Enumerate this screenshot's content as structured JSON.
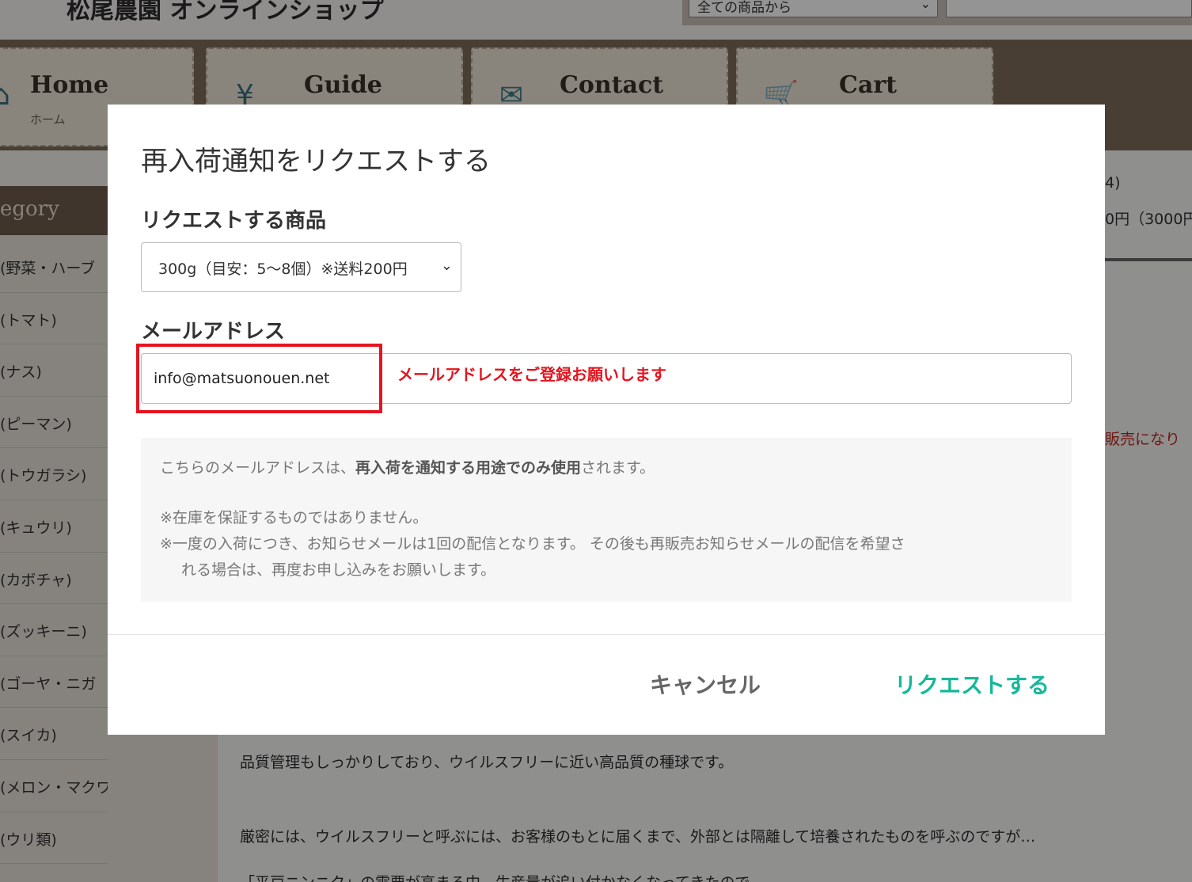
{
  "site": {
    "logo": "松尾農園 オンラインショップ",
    "search_scope": "全ての商品から"
  },
  "nav": {
    "tabs": [
      {
        "label": "Home",
        "sub": "ホーム"
      },
      {
        "label": "Guide",
        "sub": ""
      },
      {
        "label": "Contact",
        "sub": ""
      },
      {
        "label": "Cart",
        "sub": ""
      }
    ]
  },
  "sidebar": {
    "heading": "egory",
    "items": [
      "(野菜・ハーブ",
      "(トマト)",
      "(ナス)",
      "(ピーマン)",
      "(トウガラシ)",
      "(キュウリ)",
      "(カボチャ)",
      "(ズッキーニ)",
      "(ゴーヤ・ニガ",
      "(スイカ)",
      "(メロン・マクワウリ)",
      "(ウリ類)"
    ]
  },
  "main": {
    "right_line1": "4)",
    "right_line2": "0円（3000円",
    "right_red": "販売になり",
    "para1": "品質管理もしっかりしており、ウイルスフリーに近い高品質の種球です。",
    "para2": "厳密には、ウイルスフリーと呼ぶには、お客様のもとに届くまで、外部とは隔離して培養されたものを呼ぶのですが…",
    "para3": "「平戸ニンニク」の需要が高まる中、生産量が追い付かなくなってきたので"
  },
  "modal": {
    "title": "再入荷通知をリクエストする",
    "product_label": "リクエストする商品",
    "product_selected": "300g（目安：5〜8個）※送料200円",
    "email_label": "メールアドレス",
    "email_value": "info@matsuonouen.net",
    "annotation": "メールアドレスをご登録お願いします",
    "notice": {
      "line1_pre": "こちらのメールアドレスは、",
      "line1_strong": "再入荷を通知する用途でのみ使用",
      "line1_post": "されます。",
      "line2": "※在庫を保証するものではありません。",
      "line3": "※一度の入荷につき、お知らせメールは1回の配信となります。 その後も再販売お知らせメールの配信を希望さ",
      "line4": "れる場合は、再度お申し込みをお願いします。"
    },
    "cancel_label": "キャンセル",
    "submit_label": "リクエストする"
  },
  "colors": {
    "accent": "#16b89a",
    "annotation": "#e3151f"
  }
}
